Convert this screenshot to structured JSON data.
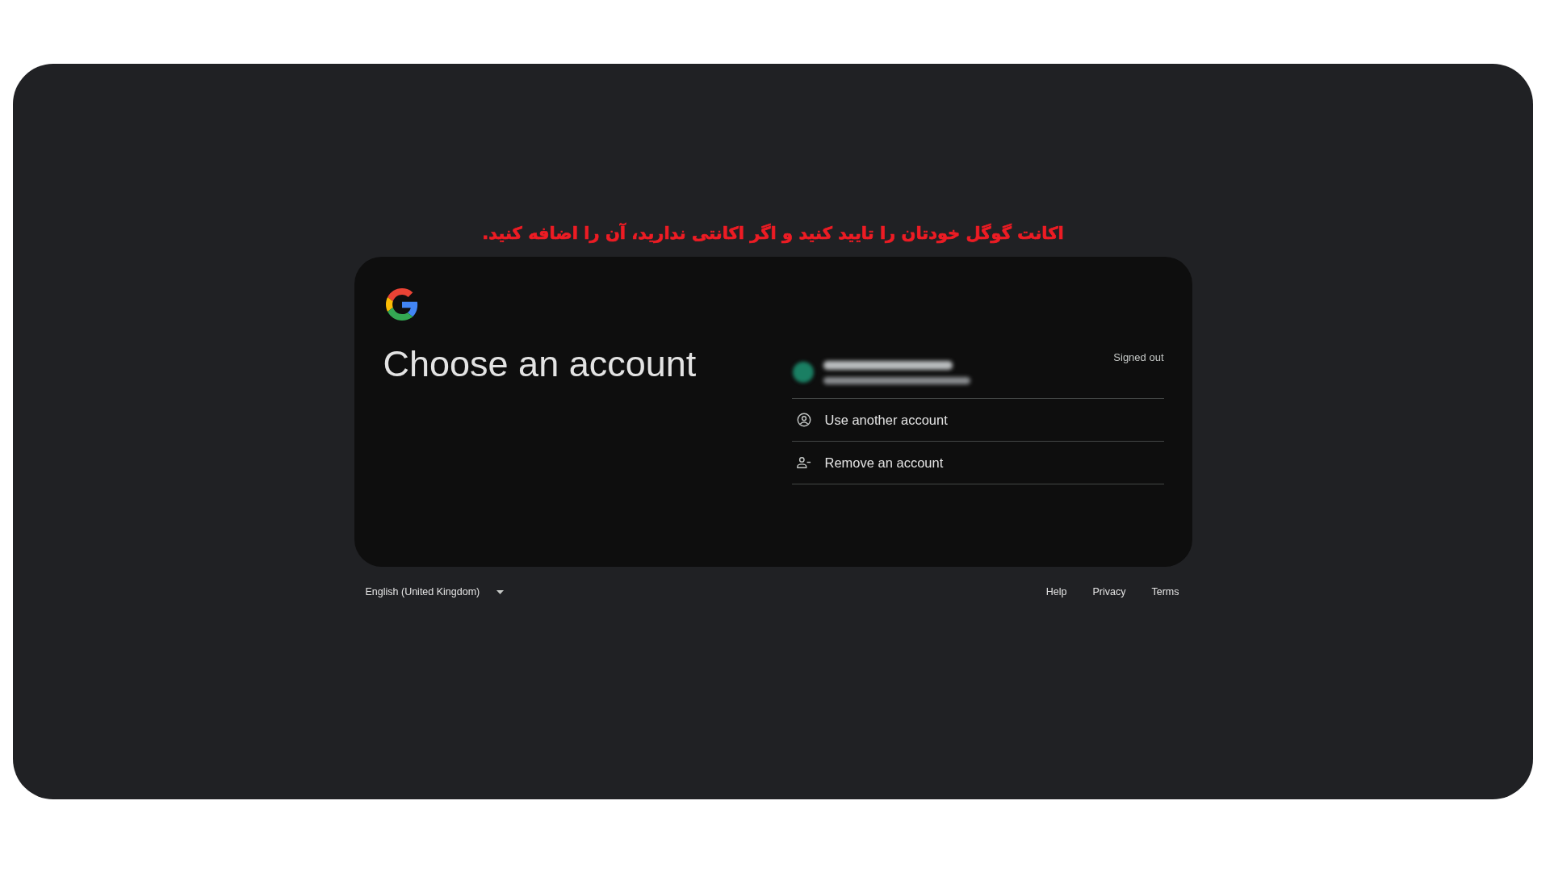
{
  "annotation": {
    "text": "اکانت گوگل خودتان را تایید کنید و اگر اکانتی ندارید، آن را اضافه کنید."
  },
  "card": {
    "title": "Choose an account",
    "accounts": [
      {
        "status": "Signed out"
      }
    ],
    "actions": [
      {
        "kind": "add",
        "label": "Use another account"
      },
      {
        "kind": "remove",
        "label": "Remove an account"
      }
    ]
  },
  "footer": {
    "language": "English (United Kingdom)",
    "links": [
      "Help",
      "Privacy",
      "Terms"
    ]
  }
}
